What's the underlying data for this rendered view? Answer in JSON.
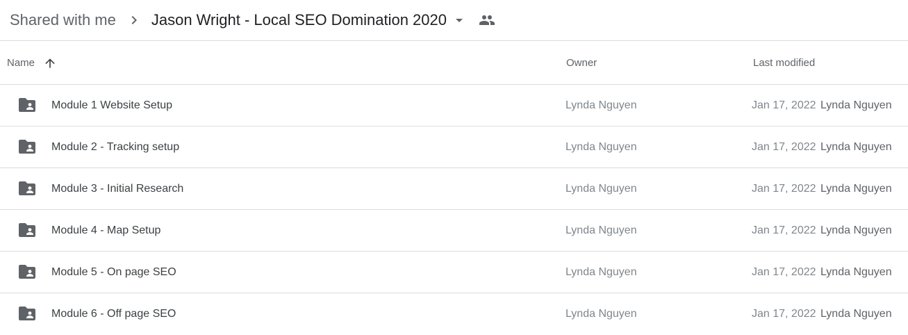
{
  "breadcrumb": {
    "root": "Shared with me",
    "current": "Jason Wright - Local SEO Domination 2020"
  },
  "columns": {
    "name": "Name",
    "owner": "Owner",
    "last_modified": "Last modified"
  },
  "sort": {
    "column": "name",
    "direction": "ascending"
  },
  "icons": {
    "separator": "chevron-right-icon",
    "dropdown": "arrow-drop-down-icon",
    "shared": "people-icon",
    "sort": "arrow-up-icon",
    "row": "shared-folder-icon"
  },
  "colors": {
    "folder_icon": "#5f6368",
    "divider": "#dadce0"
  },
  "rows": [
    {
      "name": "Module 1 Website Setup",
      "owner": "Lynda Nguyen",
      "date": "Jan 17, 2022",
      "modified_by": "Lynda Nguyen"
    },
    {
      "name": "Module 2 - Tracking setup",
      "owner": "Lynda Nguyen",
      "date": "Jan 17, 2022",
      "modified_by": "Lynda Nguyen"
    },
    {
      "name": "Module 3 - Initial Research",
      "owner": "Lynda Nguyen",
      "date": "Jan 17, 2022",
      "modified_by": "Lynda Nguyen"
    },
    {
      "name": "Module 4 - Map Setup",
      "owner": "Lynda Nguyen",
      "date": "Jan 17, 2022",
      "modified_by": "Lynda Nguyen"
    },
    {
      "name": "Module 5 - On page SEO",
      "owner": "Lynda Nguyen",
      "date": "Jan 17, 2022",
      "modified_by": "Lynda Nguyen"
    },
    {
      "name": "Module 6 - Off page SEO",
      "owner": "Lynda Nguyen",
      "date": "Jan 17, 2022",
      "modified_by": "Lynda Nguyen"
    }
  ]
}
